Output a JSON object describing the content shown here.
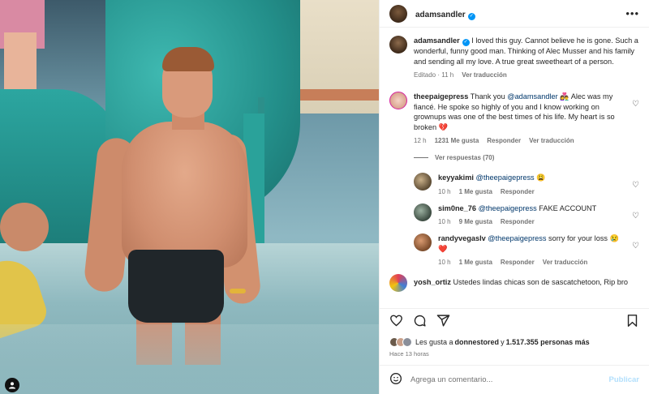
{
  "post": {
    "username": "adamsandler",
    "more_label": "•••"
  },
  "caption": {
    "username": "adamsandler",
    "text": "I loved this guy. Cannot believe he is gone. Such a wonderful, funny good man. Thinking of Alec Musser and his family and sending all my love. A true great sweetheart of a person.",
    "edited": "Editado · 11 h",
    "translate": "Ver traducción"
  },
  "comments": [
    {
      "username": "theepaigepress",
      "text_before": "Thank you ",
      "mention": "@adamsandler",
      "text_after": " 👩‍❤️‍👨 Alec was my fiancé. He spoke so highly of you and I know working on grownups was one of the best times of his life. My heart is so broken 💔",
      "time": "12 h",
      "likes": "1231 Me gusta",
      "reply": "Responder",
      "translate": "Ver traducción",
      "view_replies": "Ver respuestas (70)"
    }
  ],
  "replies": [
    {
      "username": "keyyakimi",
      "mention": "@theepaigepress",
      "text": " 😩",
      "time": "10 h",
      "likes": "1 Me gusta",
      "reply": "Responder",
      "translate": ""
    },
    {
      "username": "sim0ne_76",
      "mention": "@theepaigepress",
      "text": " FAKE ACCOUNT",
      "time": "10 h",
      "likes": "9 Me gusta",
      "reply": "Responder",
      "translate": ""
    },
    {
      "username": "randyvegaslv",
      "mention": "@theepaigepress",
      "text": " sorry for your loss 😢 ❤️",
      "time": "10 h",
      "likes": "1 Me gusta",
      "reply": "Responder",
      "translate": "Ver traducción"
    }
  ],
  "partial_comment": {
    "username": "yosh_ortiz",
    "text": "Ustedes lindas chicas son de sascatchetoon, Rip bro"
  },
  "actions": {
    "like_icon": "heart-icon",
    "comment_icon": "comment-icon",
    "share_icon": "share-icon",
    "save_icon": "bookmark-icon"
  },
  "likes_line": {
    "prefix": "Les gusta a ",
    "user": "donnestored",
    "middle": " y ",
    "count": "1.517.355 personas más"
  },
  "timestamp": "Hace 13 horas",
  "add_comment": {
    "placeholder": "Agrega un comentario...",
    "post_label": "Publicar"
  },
  "colors": {
    "verified": "#0095f6",
    "link": "#00376b",
    "muted": "#737373",
    "post_disabled": "#b2dffc"
  }
}
